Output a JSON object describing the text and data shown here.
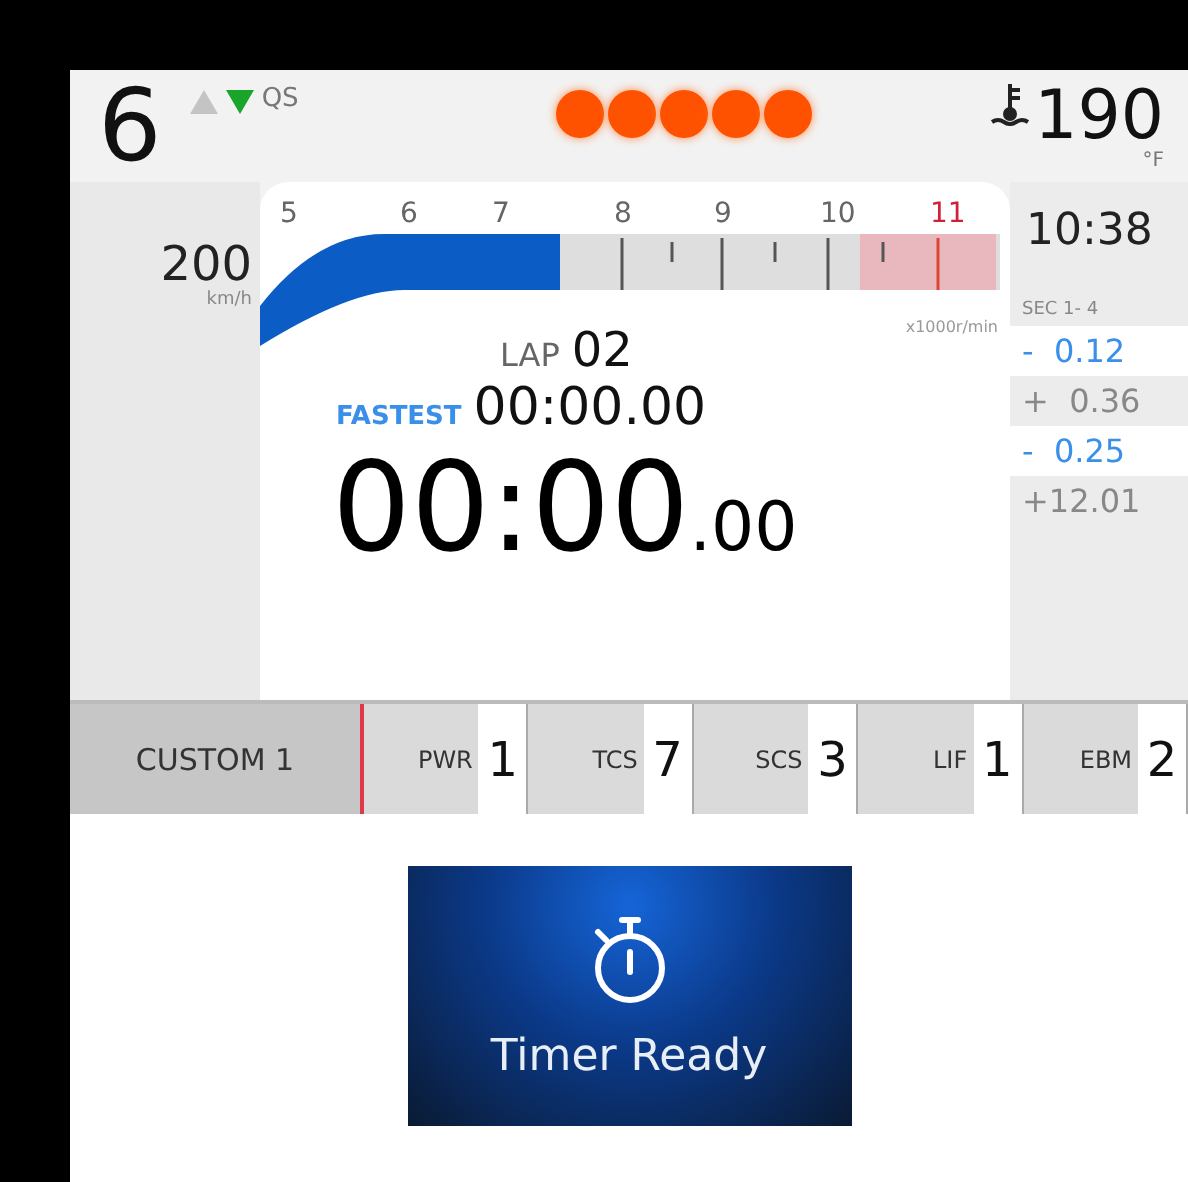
{
  "header": {
    "gear": "6",
    "shift_up_active": false,
    "shift_down_active": true,
    "quickshifter": "QS",
    "shift_lights": [
      {
        "on": true
      },
      {
        "on": true
      },
      {
        "on": true
      },
      {
        "on": true
      },
      {
        "on": true
      }
    ],
    "temperature": "190",
    "temperature_unit": "°F"
  },
  "speed": {
    "value": "200",
    "unit": "km/h"
  },
  "tachometer": {
    "labels": [
      {
        "text": "5",
        "redline": false
      },
      {
        "text": "6",
        "redline": false
      },
      {
        "text": "7",
        "redline": false
      },
      {
        "text": "8",
        "redline": false
      },
      {
        "text": "9",
        "redline": false
      },
      {
        "text": "10",
        "redline": false
      },
      {
        "text": "11",
        "redline": true
      }
    ],
    "level": 0.4,
    "unit": "x1000r/min"
  },
  "lap": {
    "label": "LAP",
    "number": "02",
    "fastest_label": "FASTEST",
    "fastest_time": "00:00.00",
    "current_time": "00:00",
    "current_fraction": ".00"
  },
  "clock": "10:38",
  "sectors": {
    "label": "SEC 1- 4",
    "rows": [
      {
        "kind": "minus",
        "text": "-  0.12"
      },
      {
        "kind": "plus",
        "text": "+  0.36"
      },
      {
        "kind": "minus",
        "text": "-  0.25"
      },
      {
        "kind": "plus",
        "text": "+12.01"
      }
    ]
  },
  "mode_bar": {
    "profile": "CUSTOM 1",
    "modes": [
      {
        "label": "PWR",
        "value": "1"
      },
      {
        "label": "TCS",
        "value": "7"
      },
      {
        "label": "SCS",
        "value": "3"
      },
      {
        "label": "LIF",
        "value": "1"
      },
      {
        "label": "EBM",
        "value": "2"
      }
    ]
  },
  "timer_card": {
    "text": "Timer Ready"
  }
}
